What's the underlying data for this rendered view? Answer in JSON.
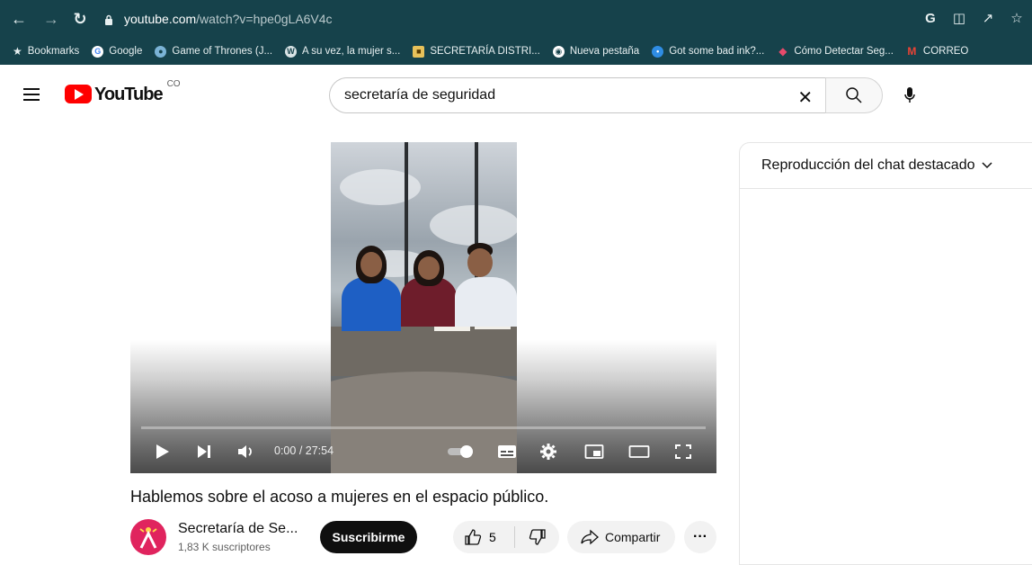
{
  "browser": {
    "url_host": "youtube.com",
    "url_path": "/watch?v=hpe0gLA6V4c",
    "bookmarks": [
      {
        "label": "Bookmarks",
        "icon": "star-icon"
      },
      {
        "label": "Google",
        "icon": "google-icon"
      },
      {
        "label": "Game of Thrones (J...",
        "icon": "got-icon"
      },
      {
        "label": "A su vez, la mujer s...",
        "icon": "wordpress-icon"
      },
      {
        "label": "SECRETARÍA DISTRI...",
        "icon": "crest-icon"
      },
      {
        "label": "Nueva pestaña",
        "icon": "chrome-icon"
      },
      {
        "label": "Got some bad ink?...",
        "icon": "ink-icon"
      },
      {
        "label": "Cómo Detectar Seg...",
        "icon": "diamond-icon"
      },
      {
        "label": "CORREO",
        "icon": "gmail-icon"
      }
    ]
  },
  "youtube": {
    "logo_text": "YouTube",
    "country": "CO",
    "search_value": "secretaría de seguridad"
  },
  "player": {
    "time_current": "0:00",
    "time_separator": " / ",
    "time_total": "27:54",
    "progress": 0
  },
  "video": {
    "title": "Hablemos sobre el acoso a mujeres en el espacio público.",
    "channel_name": "Secretaría de Se...",
    "subscribers": "1,83 K suscriptores",
    "subscribe_label": "Suscribirme",
    "likes": "5",
    "share_label": "Compartir"
  },
  "chat": {
    "header": "Reproducción del chat destacado"
  },
  "colors": {
    "chrome_bg": "#16424b",
    "youtube_red": "#ff0000",
    "subscribe_bg": "#0f0f0f"
  }
}
